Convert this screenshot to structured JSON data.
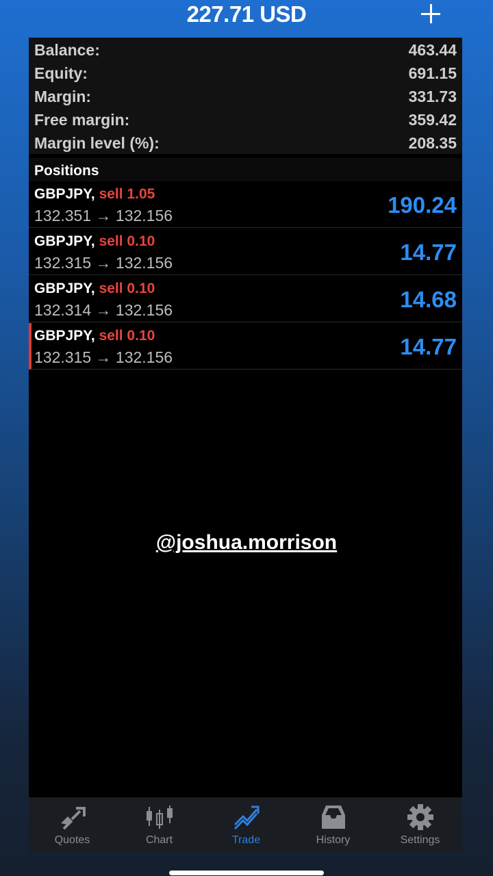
{
  "header": {
    "title": "227.71 USD"
  },
  "summary": [
    {
      "label": "Balance:",
      "value": "463.44"
    },
    {
      "label": "Equity:",
      "value": "691.15"
    },
    {
      "label": "Margin:",
      "value": "331.73"
    },
    {
      "label": "Free margin:",
      "value": "359.42"
    },
    {
      "label": "Margin level (%):",
      "value": "208.35"
    }
  ],
  "positions": {
    "title": "Positions",
    "items": [
      {
        "symbol": "GBPJPY,",
        "side": "sell 1.05",
        "prices": "132.351 → 132.156",
        "profit": "190.24"
      },
      {
        "symbol": "GBPJPY,",
        "side": "sell 0.10",
        "prices": "132.315 → 132.156",
        "profit": "14.77"
      },
      {
        "symbol": "GBPJPY,",
        "side": "sell 0.10",
        "prices": "132.314 → 132.156",
        "profit": "14.68"
      },
      {
        "symbol": "GBPJPY,",
        "side": "sell 0.10",
        "prices": "132.315 → 132.156",
        "profit": "14.77"
      }
    ]
  },
  "watermark": "@joshua.morrison",
  "tabs": [
    {
      "label": "Quotes",
      "icon": "quotes-icon"
    },
    {
      "label": "Chart",
      "icon": "chart-icon"
    },
    {
      "label": "Trade",
      "icon": "trade-icon",
      "active": true
    },
    {
      "label": "History",
      "icon": "history-icon"
    },
    {
      "label": "Settings",
      "icon": "settings-icon"
    }
  ],
  "colors": {
    "accent": "#2f7fe0",
    "profit": "#2c8df2",
    "sell": "#e8453c"
  }
}
